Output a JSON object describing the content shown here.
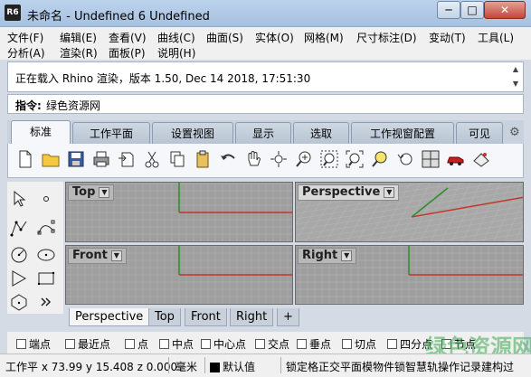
{
  "window": {
    "title": "未命名 - Undefined 6 Undefined",
    "icon_text": "R6",
    "minimize_glyph": "─",
    "maximize_glyph": "□",
    "close_glyph": "✕"
  },
  "menu": {
    "row1": [
      "文件(F)",
      "编辑(E)",
      "查看(V)",
      "曲线(C)",
      "曲面(S)",
      "实体(O)",
      "网格(M)",
      "尺寸标注(D)",
      "变动(T)",
      "工具(L)"
    ],
    "row2": [
      "分析(A)",
      "渲染(R)",
      "面板(P)",
      "说明(H)"
    ]
  },
  "command": {
    "history": "正在载入 Rhino 渲染，版本 1.50, Dec 14 2018, 17:51:30",
    "prompt_label": "指令:",
    "prompt_value": "绿色资源网"
  },
  "toolbar_tabs": [
    "标准",
    "工作平面",
    "设置视图",
    "显示",
    "选取",
    "工作视窗配置",
    "可见"
  ],
  "active_tab": "标准",
  "toolbar_icons": [
    "new-file-icon",
    "open-folder-icon",
    "save-icon",
    "print-icon",
    "import-icon",
    "cut-icon",
    "copy-icon",
    "paste-icon",
    "undo-icon",
    "pan-hand-icon",
    "rotate-view-icon",
    "zoom-dynamic-icon",
    "zoom-window-icon",
    "zoom-extents-icon",
    "zoom-selected-icon",
    "undo-view-icon",
    "four-viewports-icon",
    "car-render-icon",
    "properties-icon"
  ],
  "sidebar_icons": [
    "select-arrow-icon",
    "point-icon",
    "polyline-icon",
    "curve-points-icon",
    "circle-icon",
    "ellipse-icon",
    "arc-icon",
    "rectangle-icon",
    "polygon-icon",
    "more-tools-icon"
  ],
  "viewports": [
    {
      "name": "Top",
      "active": false
    },
    {
      "name": "Perspective",
      "active": true
    },
    {
      "name": "Front",
      "active": false
    },
    {
      "name": "Right",
      "active": false
    }
  ],
  "viewport_tabs": [
    "Perspective",
    "Top",
    "Front",
    "Right",
    "+"
  ],
  "active_viewport_tab": "Perspective",
  "osnaps": [
    "端点",
    "最近点",
    "点",
    "中点",
    "中心点",
    "交点",
    "垂点",
    "切点",
    "四分点",
    "节点"
  ],
  "status": {
    "coords": "工作平 x 73.99 y 15.408 z 0.000",
    "units": "毫米",
    "layer": "默认值",
    "modes": "锁定格正交平面模物件锁智慧轨操作记录建构过"
  },
  "watermark": "绿色资源网",
  "colors": {
    "x_axis": "#c0392b",
    "y_axis": "#2e8b2e",
    "grid_bg": "#9e9e9e",
    "grid_line": "#b4b4b4",
    "accent": "#3399ff"
  }
}
